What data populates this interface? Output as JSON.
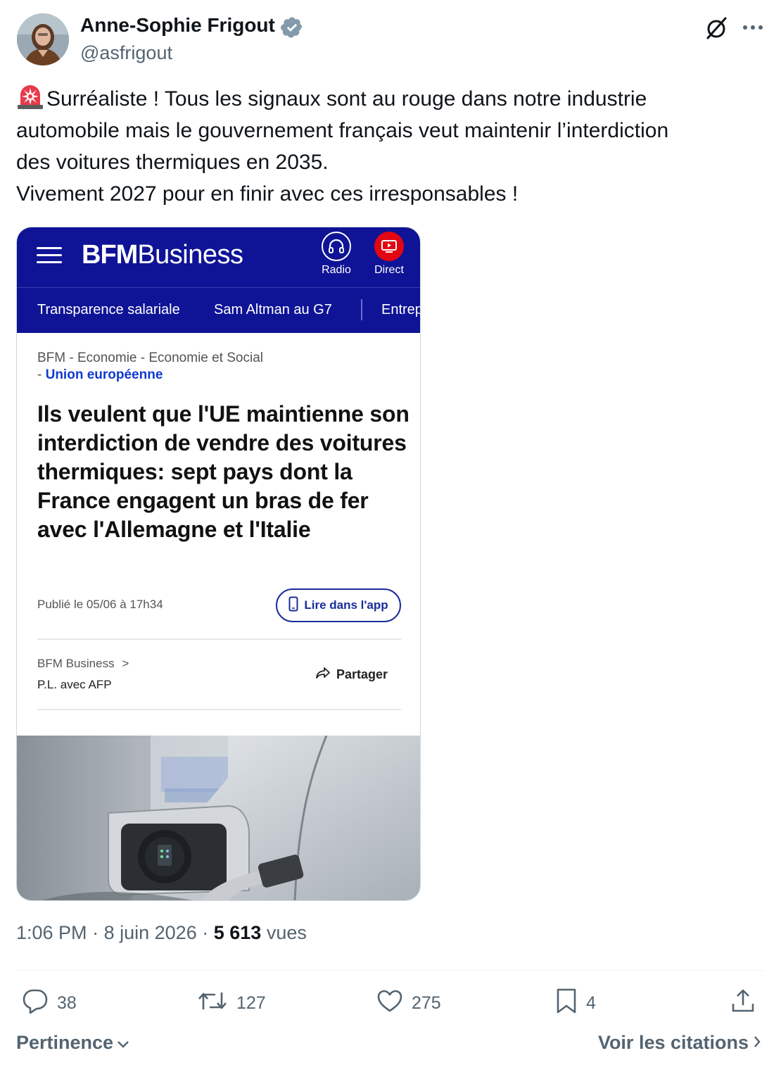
{
  "author": {
    "name": "Anne-Sophie Frigout",
    "handle": "@asfrigout",
    "verified": true
  },
  "tweet": {
    "lines": [
      "Surréaliste ! Tous les signaux sont au rouge dans notre industrie",
      "automobile mais le gouvernement français veut maintenir l’interdiction",
      "des voitures thermiques en 2035.",
      "Vivement 2027 pour en finir avec ces irresponsables !"
    ]
  },
  "media": {
    "brand_bold": "BFM",
    "brand_light": "Business",
    "radio_label": "Radio",
    "direct_label": "Direct",
    "nav_items": [
      "Transparence salariale",
      "Sam Altman au G7",
      "Entrep"
    ],
    "breadcrumb": "BFM - Economie - Economie et Social",
    "breadcrumb_tail_prefix": "- ",
    "breadcrumb_tail": "Union européenne",
    "headline": "Ils veulent que l'UE maintienne son interdiction de vendre des voitures thermiques: sept pays dont la France engagent un bras de fer avec l'Allemagne et l'Italie",
    "published": "Publié le 05/06 à 17h34",
    "app_button": "Lire dans l'app",
    "source": "BFM Business",
    "source_chevron": ">",
    "byline": "P.L. avec AFP",
    "share_label": "Partager"
  },
  "meta": {
    "time": "1:06 PM",
    "dot": "·",
    "date": "8 juin 2026",
    "views_count": "5 613",
    "views_label": "vues"
  },
  "actions": {
    "replies": "38",
    "retweets": "127",
    "likes": "275",
    "bookmarks": "4"
  },
  "footer": {
    "sort_label": "Pertinence",
    "quotes_label": "Voir les citations"
  },
  "colors": {
    "bfm_blue": "#0f1396",
    "bfm_red": "#e20613",
    "muted": "#536471",
    "verified_badge": "#829aab"
  },
  "icons": [
    "siren-icon",
    "verified-icon",
    "grok-icon",
    "more-icon",
    "hamburger-icon",
    "headphones-icon",
    "play-icon",
    "phone-icon",
    "chevron-right-icon",
    "share-arrow-icon",
    "reply-icon",
    "retweet-icon",
    "like-icon",
    "bookmark-icon",
    "share-icon",
    "chevron-down-icon"
  ]
}
